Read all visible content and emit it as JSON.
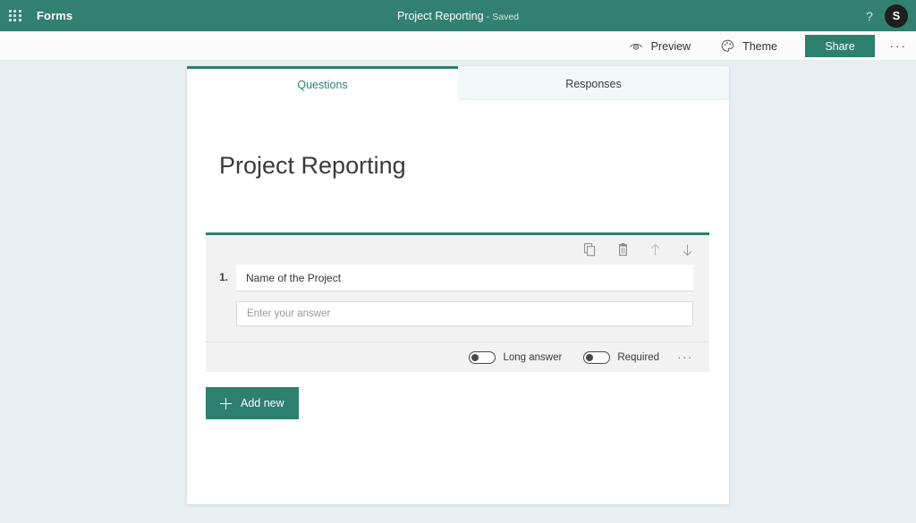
{
  "header": {
    "waffle_icon": "app-launcher-icon",
    "brand": "Forms",
    "document_title": "Project Reporting",
    "separator": "-",
    "save_status": "Saved",
    "help_icon": "?",
    "avatar_initial": "S"
  },
  "toolbar": {
    "preview_label": "Preview",
    "preview_icon": "eye-icon",
    "theme_label": "Theme",
    "theme_icon": "palette-icon",
    "share_label": "Share",
    "more_label": "···"
  },
  "tabs": [
    {
      "label": "Questions",
      "active": true
    },
    {
      "label": "Responses",
      "active": false
    }
  ],
  "form": {
    "title": "Project Reporting"
  },
  "question": {
    "number": "1.",
    "text": "Name of the Project",
    "answer_placeholder": "Enter your answer",
    "tools": [
      {
        "name": "copy-icon",
        "label": "Copy question"
      },
      {
        "name": "delete-icon",
        "label": "Delete question"
      },
      {
        "name": "move-up-icon",
        "label": "Move up"
      },
      {
        "name": "move-down-icon",
        "label": "Move down"
      }
    ],
    "toggles": [
      {
        "label": "Long answer",
        "on": false
      },
      {
        "label": "Required",
        "on": false
      }
    ],
    "more_label": "···"
  },
  "actions": {
    "add_new_label": "Add new"
  },
  "colors": {
    "brand_green": "#32806f",
    "accent_green": "#2d7f6e",
    "page_background": "#e8eff2",
    "card_background": "#f2f2f2",
    "panel_background": "#ffffff"
  }
}
